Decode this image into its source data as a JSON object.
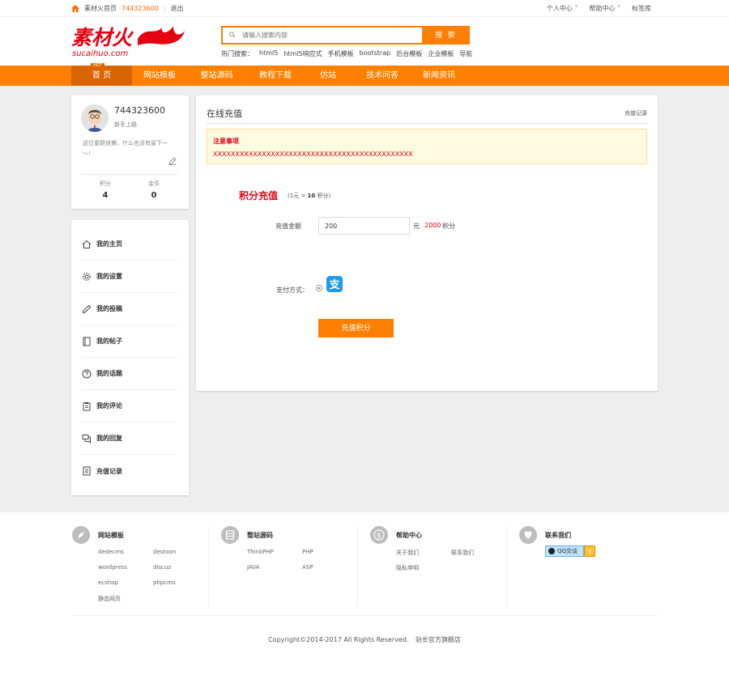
{
  "topbar": {
    "home_link": "素材火首页",
    "user_id": "744323600",
    "logout": "退出",
    "user_center": "个人中心",
    "help_center": "帮助中心",
    "tag": "标签库"
  },
  "header": {
    "logo_cn": "素材火",
    "logo_en": "sucaihuo.com",
    "search_placeholder": "请输入搜索内容",
    "search_button": "搜 索",
    "hot_label": "热门搜索：",
    "hot_terms": [
      "html5",
      "html5响应式",
      "手机模板",
      "bootstrap",
      "后台模板",
      "企业模板",
      "导航"
    ]
  },
  "nav": {
    "items": [
      "首 页",
      "网站模板",
      "整站源码",
      "教程下载",
      "仿站",
      "技术问答",
      "新闻资讯"
    ],
    "badge": "HOT"
  },
  "profile": {
    "username": "744323600",
    "level": "新手上路",
    "bio": "这位童鞋很懒，什么也没有留下～～！",
    "points_label": "积分",
    "points_value": "4",
    "coins_label": "金币",
    "coins_value": "0"
  },
  "menu": {
    "items": [
      "我的主页",
      "我的设置",
      "我的投稿",
      "我的帖子",
      "我的话题",
      "我的评论",
      "我的回复",
      "充值记录"
    ]
  },
  "recharge": {
    "title": "在线充值",
    "record_link": "充值记录",
    "notice_title": "注意事项",
    "notice_text": "XXXXXXXXXXXXXXXXXXXXXXXXXXXXXXXXXXXXXXXXXXXXX",
    "section_title": "积分充值",
    "rate_prefix": "(1元 = ",
    "rate_value": "10",
    "rate_suffix": " 积分)",
    "amount_label": "充值金额",
    "amount_value": "200",
    "yuan": "元",
    "points_calc": "2000",
    "points_unit": "积分",
    "pay_label": "支付方式：",
    "submit": "充值积分"
  },
  "footer": {
    "col1": {
      "title": "网站模板",
      "links": [
        "dedecms",
        "destoon",
        "wordpress",
        "discuz",
        "ecshop",
        "phpcms",
        "静态网页"
      ]
    },
    "col2": {
      "title": "整站源码",
      "links": [
        "ThinkPHP",
        "PHP",
        "JAVA",
        "ASP"
      ]
    },
    "col3": {
      "title": "帮助中心",
      "links": [
        "关于我们",
        "联系我们",
        "隐私申明"
      ]
    },
    "col4": {
      "title": "联系我们",
      "qq": "QQ交谈"
    },
    "copyright": "Copyright©2014-2017 All Rights Reserved.",
    "store": "站长官方旗舰店"
  },
  "colors": {
    "accent": "#ff8000",
    "nav_active": "#d96500",
    "red": "#e60012",
    "alipay": "#1e9be8"
  }
}
